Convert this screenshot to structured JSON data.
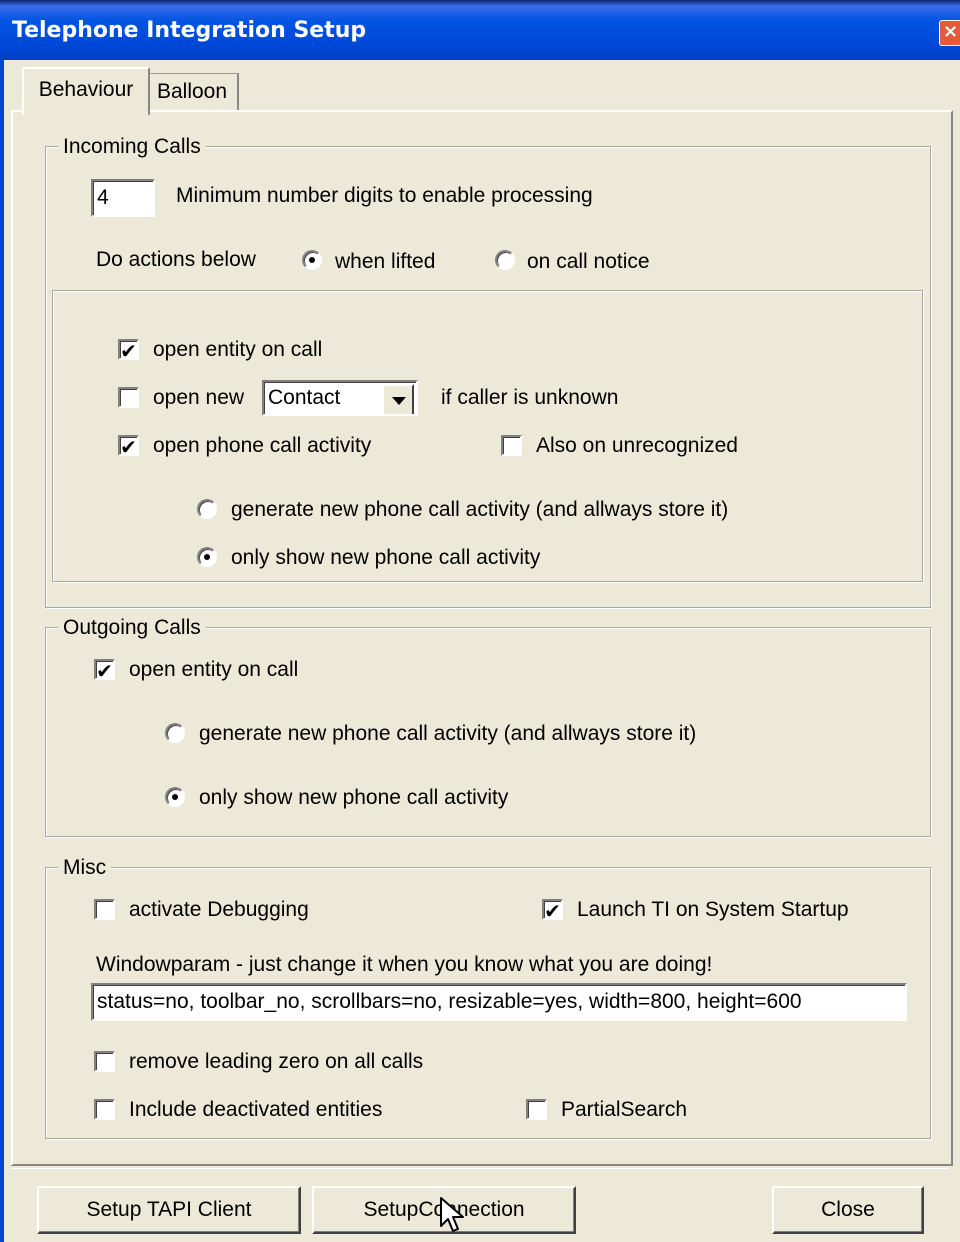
{
  "window": {
    "title": "Telephone Integration Setup",
    "close_label": "×"
  },
  "tabs": [
    {
      "label": "Behaviour"
    },
    {
      "label": "Balloon"
    }
  ],
  "incoming": {
    "title": "Incoming Calls",
    "min_digits_value": "4",
    "min_digits_label": "Minimum number digits to enable processing",
    "do_actions_label": "Do actions below",
    "when_lifted_label": "when lifted",
    "on_call_notice_label": "on call notice",
    "open_entity_label": "open entity on call",
    "open_new_label": "open new",
    "entity_type_value": "Contact",
    "if_unknown_label": "if caller is unknown",
    "open_activity_label": "open phone call activity",
    "also_unrecognized_label": "Also on unrecognized",
    "generate_label": "generate new phone call activity (and allways store it)",
    "only_show_label": "only show new phone call activity"
  },
  "outgoing": {
    "title": "Outgoing Calls",
    "open_entity_label": "open entity on call",
    "generate_label": "generate new phone call activity (and allways store it)",
    "only_show_label": "only show new phone call activity"
  },
  "misc": {
    "title": "Misc",
    "debug_label": "activate Debugging",
    "launch_label": "Launch TI on System Startup",
    "windowparam_label": "Windowparam - just change it when you know what you are doing!",
    "windowparam_value": "status=no, toolbar_no, scrollbars=no, resizable=yes, width=800, height=600",
    "remove_zero_label": "remove leading zero on all calls",
    "include_deactivated_label": "Include deactivated entities",
    "partial_search_label": "PartialSearch"
  },
  "buttons": {
    "setup_tapi": "Setup TAPI Client",
    "setup_connection": "SetupConnection",
    "close": "Close"
  },
  "check_mark": "✔"
}
